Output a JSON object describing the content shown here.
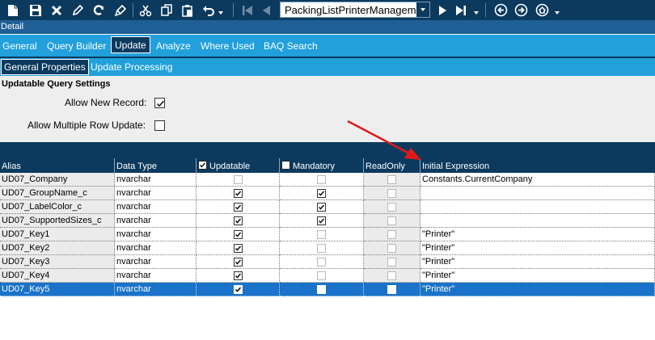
{
  "toolbar": {
    "icons": [
      "new-icon",
      "save-icon",
      "delete-icon",
      "pencil-icon",
      "refresh-icon",
      "clear-icon",
      "cut-icon",
      "copy-icon",
      "paste-icon",
      "undo-icon",
      "first-record-icon",
      "previous-record-icon",
      "next-record-icon",
      "last-record-icon",
      "back-icon",
      "forward-icon",
      "home-icon"
    ],
    "query_select_value": "PackingListPrinterManagement"
  },
  "detail_label": "Detail",
  "main_tabs": [
    {
      "label": "General",
      "active": false
    },
    {
      "label": "Query Builder",
      "active": false
    },
    {
      "label": "Update",
      "active": true
    },
    {
      "label": "Analyze",
      "active": false
    },
    {
      "label": "Where Used",
      "active": false
    },
    {
      "label": "BAQ Search",
      "active": false
    }
  ],
  "sub_tabs": [
    {
      "label": "General Properties",
      "active": true
    },
    {
      "label": "Update  Processing",
      "active": false
    }
  ],
  "settings": {
    "title": "Updatable Query Settings",
    "allow_new_record_label": "Allow New Record:",
    "allow_new_record": true,
    "allow_multiple_row_label": "Allow Multiple Row Update:",
    "allow_multiple_row": false
  },
  "grid": {
    "columns": [
      {
        "key": "alias",
        "label": "Alias"
      },
      {
        "key": "data_type",
        "label": "Data Type"
      },
      {
        "key": "updatable",
        "label": "Updatable",
        "header_checkbox": true,
        "header_checked": true
      },
      {
        "key": "mandatory",
        "label": "Mandatory",
        "header_checkbox": true,
        "header_checked": false
      },
      {
        "key": "readonly",
        "label": "ReadOnly"
      },
      {
        "key": "initial_expression",
        "label": "Initial Expression"
      }
    ],
    "rows": [
      {
        "alias": "UD07_Company",
        "data_type": "nvarchar",
        "updatable": false,
        "mandatory": false,
        "readonly": false,
        "initial_expression": "Constants.CurrentCompany",
        "selected": false
      },
      {
        "alias": "UD07_GroupName_c",
        "data_type": "nvarchar",
        "updatable": true,
        "mandatory": true,
        "readonly": false,
        "initial_expression": "",
        "selected": false
      },
      {
        "alias": "UD07_LabelColor_c",
        "data_type": "nvarchar",
        "updatable": true,
        "mandatory": true,
        "readonly": false,
        "initial_expression": "",
        "selected": false
      },
      {
        "alias": "UD07_SupportedSizes_c",
        "data_type": "nvarchar",
        "updatable": true,
        "mandatory": true,
        "readonly": false,
        "initial_expression": "",
        "selected": false
      },
      {
        "alias": "UD07_Key1",
        "data_type": "nvarchar",
        "updatable": true,
        "mandatory": false,
        "readonly": false,
        "initial_expression": "\"Printer\"",
        "selected": false
      },
      {
        "alias": "UD07_Key2",
        "data_type": "nvarchar",
        "updatable": true,
        "mandatory": false,
        "readonly": false,
        "initial_expression": "\"Printer\"",
        "selected": false
      },
      {
        "alias": "UD07_Key3",
        "data_type": "nvarchar",
        "updatable": true,
        "mandatory": false,
        "readonly": false,
        "initial_expression": "\"Printer\"",
        "selected": false
      },
      {
        "alias": "UD07_Key4",
        "data_type": "nvarchar",
        "updatable": true,
        "mandatory": false,
        "readonly": false,
        "initial_expression": "\"Printer\"",
        "selected": false
      },
      {
        "alias": "UD07_Key5",
        "data_type": "nvarchar",
        "updatable": true,
        "mandatory": false,
        "readonly": false,
        "initial_expression": "\"Printer\"",
        "selected": true
      }
    ]
  },
  "colors": {
    "toolbar_bg": "#0b3a5e",
    "tab_bar": "#21a0dc",
    "selected_row": "#1a73c8",
    "annotation_arrow": "#e01a1a"
  }
}
